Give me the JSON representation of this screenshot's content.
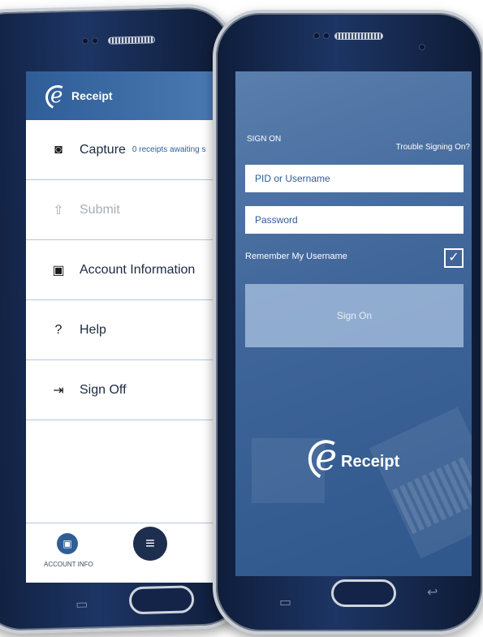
{
  "brand": {
    "name": "Receipt",
    "logo_letter": "e"
  },
  "left_app": {
    "menu": [
      {
        "icon": "camera-icon",
        "glyph": "◙",
        "label": "Capture",
        "sub": "0 receipts awaiting s",
        "enabled": true
      },
      {
        "icon": "upload-icon",
        "glyph": "⇧",
        "label": "Submit",
        "sub": "",
        "enabled": false
      },
      {
        "icon": "account-icon",
        "glyph": "▣",
        "label": "Account Information",
        "sub": "",
        "enabled": true
      },
      {
        "icon": "help-icon",
        "glyph": "?",
        "label": "Help",
        "sub": "",
        "enabled": true
      },
      {
        "icon": "sign-off-icon",
        "glyph": "⇥",
        "label": "Sign Off",
        "sub": "",
        "enabled": true
      }
    ],
    "bottom_nav": {
      "account_label": "ACCOUNT INFO",
      "account_glyph": "▣",
      "menu_glyph": "≡"
    }
  },
  "right_app": {
    "section_title": "SIGN ON",
    "trouble_link": "Trouble Signing On?",
    "username_placeholder": "PID or Username",
    "password_placeholder": "Password",
    "remember_label": "Remember My Username",
    "remember_checked": true,
    "check_glyph": "✓",
    "sign_on_button": "Sign On"
  },
  "device_keys": {
    "recents_glyph": "▭",
    "back_glyph": "↩"
  },
  "colors": {
    "header_blue": "#2f5d97",
    "screen_blue": "#3f6599",
    "phone_navy": "#1d3564"
  }
}
